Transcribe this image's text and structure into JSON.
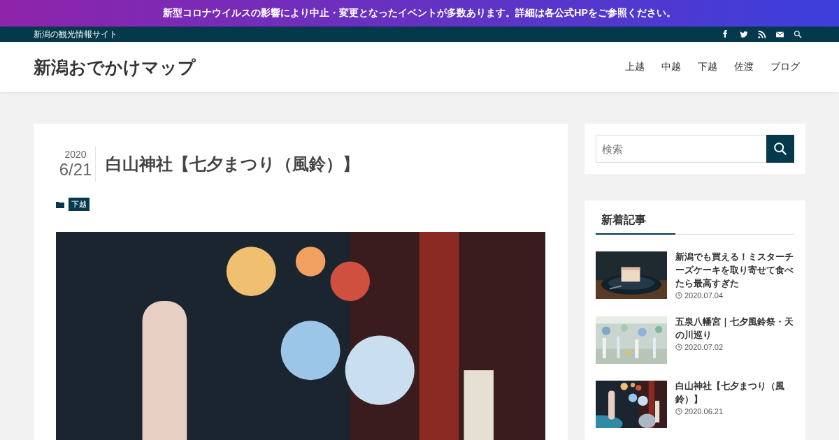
{
  "announcement": "新型コロナウイルスの影響により中止・変更となったイベントが多数あります。詳細は各公式HPをご参照ください。",
  "topbar": {
    "tagline": "新潟の観光情報サイト",
    "icons": [
      {
        "kind": "facebook"
      },
      {
        "kind": "twitter"
      },
      {
        "kind": "rss"
      },
      {
        "kind": "mail"
      },
      {
        "kind": "search"
      }
    ]
  },
  "header": {
    "site_title": "新潟おでかけマップ",
    "nav": [
      "上越",
      "中越",
      "下越",
      "佐渡",
      "ブログ"
    ]
  },
  "article": {
    "year": "2020",
    "date": "6/21",
    "title": "白山神社【七夕まつり（風鈴）】",
    "category": "下越",
    "image": {
      "kind": "night"
    }
  },
  "sidebar": {
    "search": {
      "placeholder": "検索"
    },
    "recent": {
      "heading": "新着記事",
      "posts": [
        {
          "title": "新潟でも買える！ミスターチーズケーキを取り寄せて食べたら最高すぎた",
          "date": "2020.07.04",
          "thumb": {
            "kind": "food"
          }
        },
        {
          "title": "五泉八幡宮｜七夕風鈴祭・天の川巡り",
          "date": "2020.07.02",
          "thumb": {
            "kind": "day"
          }
        },
        {
          "title": "白山神社【七夕まつり（風鈴）】",
          "date": "2020.06.21",
          "thumb": {
            "kind": "night"
          }
        }
      ]
    }
  }
}
